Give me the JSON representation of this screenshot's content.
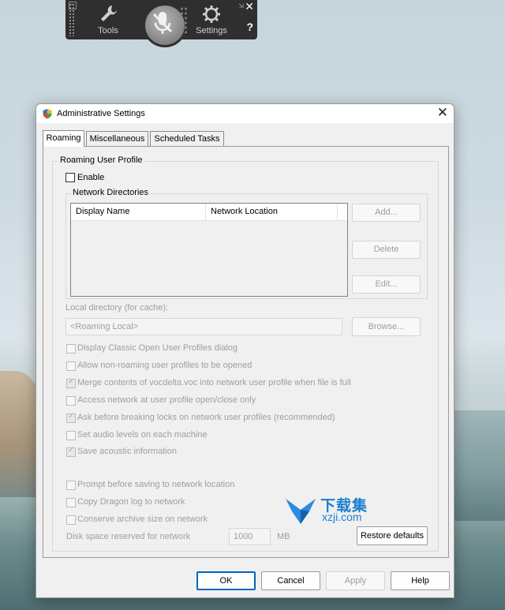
{
  "dragon_bar": {
    "tools_label": "Tools",
    "settings_label": "Settings",
    "close_glyph": "✕",
    "help_glyph": "?"
  },
  "dialog": {
    "title": "Administrative Settings",
    "close_glyph": "✕"
  },
  "tabs": [
    {
      "label": "Roaming",
      "active": true
    },
    {
      "label": "Miscellaneous",
      "active": false
    },
    {
      "label": "Scheduled Tasks",
      "active": false
    }
  ],
  "roaming": {
    "group_label": "Roaming User Profile",
    "enable_label": "Enable",
    "enable_checked": false,
    "network_dirs_label": "Network Directories",
    "columns": [
      "Display Name",
      "Network Location"
    ],
    "rows": [],
    "add_label": "Add...",
    "delete_label": "Delete",
    "edit_label": "Edit...",
    "local_dir_label": "Local directory (for cache):",
    "local_dir_value": "<Roaming Local>",
    "browse_label": "Browse...",
    "options": [
      {
        "label": "Display Classic Open User Profiles dialog",
        "checked": false
      },
      {
        "label": "Allow non-roaming user profiles to be opened",
        "checked": false
      },
      {
        "label": "Merge contents of vocdelta.voc into network user profile when file is full",
        "checked": true
      },
      {
        "label": "Access network at user profile open/close only",
        "checked": false
      },
      {
        "label": "Ask before breaking locks on network user profiles (recommended)",
        "checked": true
      },
      {
        "label": "Set audio levels on each machine",
        "checked": false
      },
      {
        "label": "Save acoustic information",
        "checked": true
      }
    ],
    "options2": [
      {
        "label": "Prompt before saving to network location",
        "checked": false
      },
      {
        "label": "Copy Dragon log to network",
        "checked": false
      },
      {
        "label": "Conserve archive size on network",
        "checked": false
      }
    ],
    "disk_space_label": "Disk space reserved for network",
    "disk_space_value": "1000",
    "disk_space_unit": "MB",
    "restore_label": "Restore defaults"
  },
  "footer": {
    "ok_label": "OK",
    "cancel_label": "Cancel",
    "apply_label": "Apply",
    "help_label": "Help"
  },
  "watermark": {
    "line1": "下载集",
    "line2": "xzji.com"
  },
  "colors": {
    "accent": "#0067c0",
    "watermark": "#1e7fd0"
  }
}
